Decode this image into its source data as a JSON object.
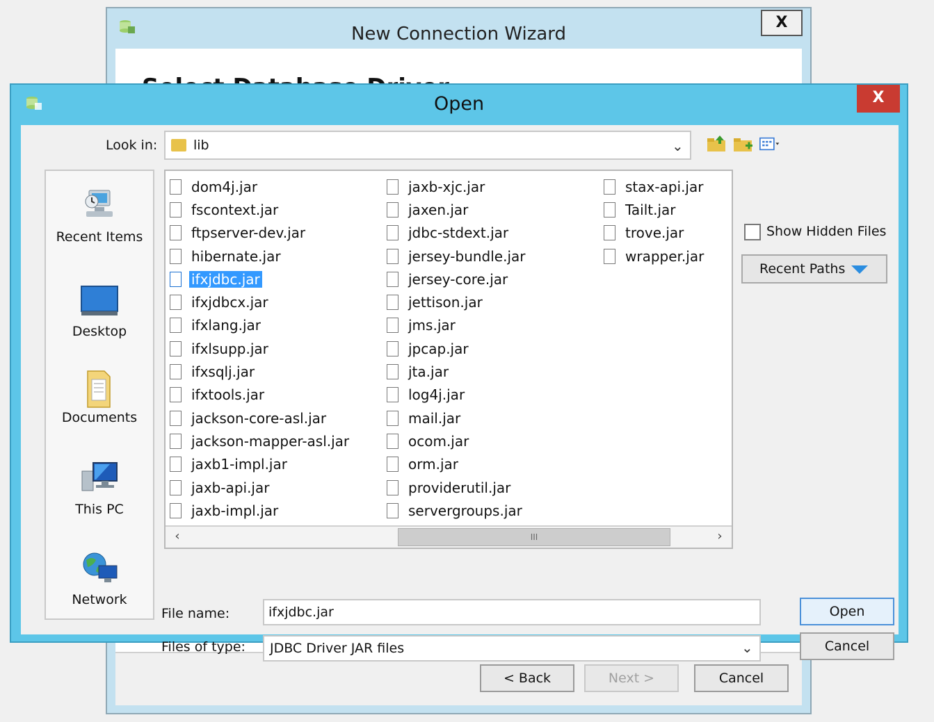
{
  "wizard": {
    "title": "New Connection Wizard",
    "close_label": "X",
    "heading": "Select Database Driver",
    "buttons": {
      "back": "< Back",
      "next": "Next >",
      "cancel": "Cancel"
    }
  },
  "open_dialog": {
    "title": "Open",
    "close_label": "X",
    "look_in_label": "Look in:",
    "look_in_value": "lib",
    "places": [
      "Recent Items",
      "Desktop",
      "Documents",
      "This PC",
      "Network"
    ],
    "files": {
      "column1": [
        "dom4j.jar",
        "fscontext.jar",
        "ftpserver-dev.jar",
        "hibernate.jar",
        "ifxjdbc.jar",
        "ifxjdbcx.jar",
        "ifxlang.jar",
        "ifxlsupp.jar",
        "ifxsqlj.jar",
        "ifxtools.jar",
        "jackson-core-asl.jar",
        "jackson-mapper-asl.jar",
        "jaxb1-impl.jar",
        "jaxb-api.jar",
        "jaxb-impl.jar"
      ],
      "column2": [
        "jaxb-xjc.jar",
        "jaxen.jar",
        "jdbc-stdext.jar",
        "jersey-bundle.jar",
        "jersey-core.jar",
        "jettison.jar",
        "jms.jar",
        "jpcap.jar",
        "jta.jar",
        "log4j.jar",
        "mail.jar",
        "ocom.jar",
        "orm.jar",
        "providerutil.jar",
        "servergroups.jar"
      ],
      "column3": [
        "stax-api.jar",
        "Tailt.jar",
        "trove.jar",
        "wrapper.jar"
      ],
      "selected": "ifxjdbc.jar"
    },
    "scroll_grip": "III",
    "show_hidden_label": "Show Hidden Files",
    "show_hidden_checked": false,
    "recent_paths_label": "Recent Paths",
    "file_name_label": "File name:",
    "file_name_value": "ifxjdbc.jar",
    "files_of_type_label": "Files of type:",
    "files_of_type_value": "JDBC Driver JAR files",
    "buttons": {
      "open": "Open",
      "cancel": "Cancel"
    }
  },
  "colors": {
    "title_bar": "#5dc6e8",
    "close_button": "#c93b31",
    "selection": "#3399ff"
  }
}
